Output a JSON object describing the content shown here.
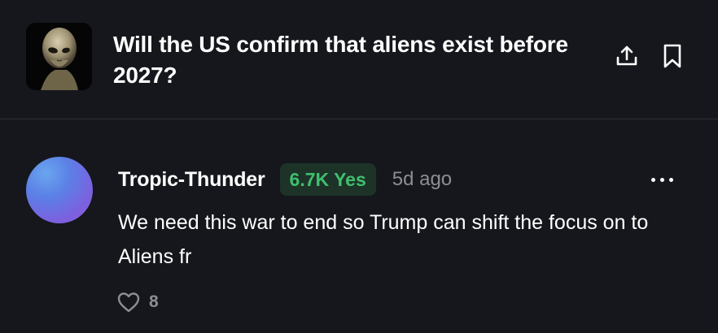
{
  "market": {
    "title": "Will the US confirm that aliens exist before 2027?",
    "thumbnail_icon": "alien-portrait-icon",
    "share_icon": "share-upload-icon",
    "bookmark_icon": "bookmark-icon"
  },
  "comment": {
    "username": "Tropic-Thunder",
    "position_badge": "6.7K Yes",
    "timestamp": "5d ago",
    "text": "We need this war to end so Trump can shift the focus on to Aliens fr",
    "like_count": "8",
    "more_icon": "more-dots-icon",
    "like_icon": "heart-icon"
  },
  "colors": {
    "background": "#15171c",
    "yes_green": "#3fbf6e",
    "muted_text": "#8b8e95"
  }
}
